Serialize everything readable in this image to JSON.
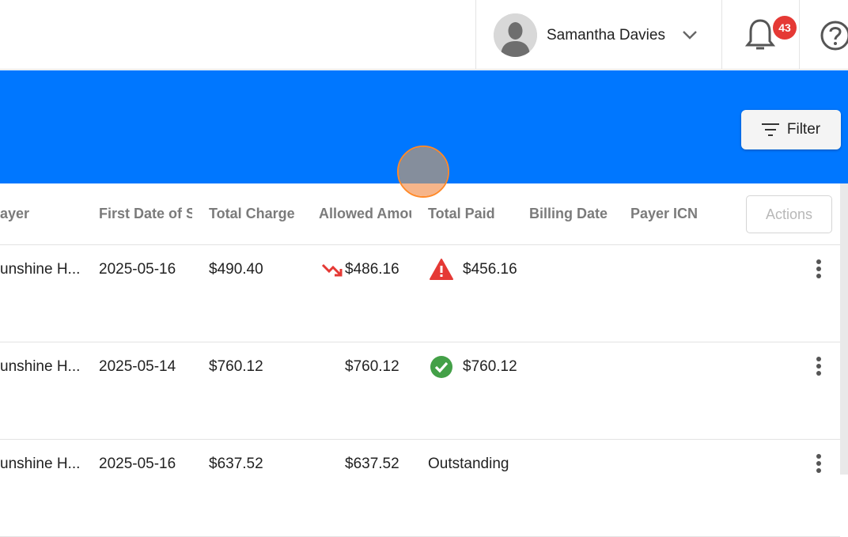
{
  "header": {
    "user_name": "Samantha Davies",
    "notification_count": "43"
  },
  "banner": {
    "filter_label": "Filter",
    "accent_color": "#0077ff"
  },
  "table": {
    "columns": [
      "ayer",
      "First Date of S",
      "Total Charge",
      "Allowed Amou",
      "Total Paid",
      "Billing Date",
      "Payer ICN"
    ],
    "actions_label": "Actions",
    "rows": [
      {
        "payer": "unshine H...",
        "first_date": "2025-05-16",
        "total_charge": "$490.40",
        "allowed": "$486.16",
        "allowed_icon": "trending-down-icon",
        "paid": "$456.16",
        "paid_icon": "warning-icon"
      },
      {
        "payer": "unshine H...",
        "first_date": "2025-05-14",
        "total_charge": "$760.12",
        "allowed": "$760.12",
        "allowed_icon": "",
        "paid": "$760.12",
        "paid_icon": "check-circle-icon"
      },
      {
        "payer": "unshine H...",
        "first_date": "2025-05-16",
        "total_charge": "$637.52",
        "allowed": "$637.52",
        "allowed_icon": "",
        "paid": "Outstanding",
        "paid_icon": ""
      }
    ]
  },
  "colors": {
    "warning": "#e53935",
    "success": "#43a047",
    "trend_down": "#e53935"
  }
}
